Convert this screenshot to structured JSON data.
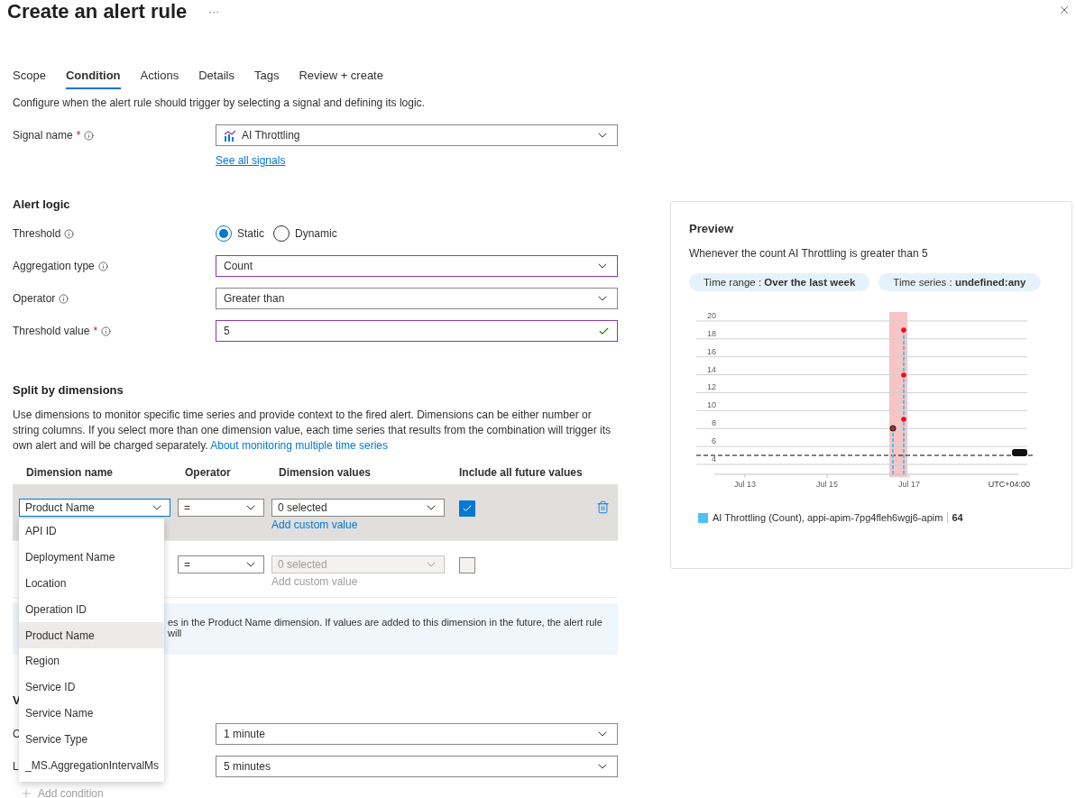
{
  "header": {
    "title": "Create an alert rule",
    "more": "···"
  },
  "tabs": [
    {
      "label": "Scope",
      "selected": false
    },
    {
      "label": "Condition",
      "selected": true
    },
    {
      "label": "Actions",
      "selected": false
    },
    {
      "label": "Details",
      "selected": false
    },
    {
      "label": "Tags",
      "selected": false
    },
    {
      "label": "Review + create",
      "selected": false
    }
  ],
  "intro": "Configure when the alert rule should trigger by selecting a signal and defining its logic.",
  "signal": {
    "label": "Signal name",
    "required_mark": "*",
    "info": true,
    "value": "AI Throttling",
    "link": "See all signals"
  },
  "alert_logic": {
    "heading": "Alert logic",
    "threshold": {
      "label": "Threshold",
      "info": true,
      "options": [
        {
          "label": "Static",
          "selected": true
        },
        {
          "label": "Dynamic",
          "selected": false
        }
      ]
    },
    "fields": [
      {
        "kind": "select",
        "label": "Aggregation type",
        "info": true,
        "value": "Count",
        "focused": true
      },
      {
        "kind": "select",
        "label": "Operator",
        "info": true,
        "value": "Greater than",
        "focused": false
      },
      {
        "kind": "text",
        "label": "Threshold value",
        "required_mark": "*",
        "info": true,
        "value": "5",
        "focused": true,
        "valid": true
      }
    ]
  },
  "split": {
    "heading": "Split by dimensions",
    "description": "Use dimensions to monitor specific time series and provide context to the fired alert. Dimensions can be either number or string columns. If you select more than one dimension value, each time series that results from the combination will trigger its own alert and will be charged separately.",
    "link": "About monitoring multiple time series",
    "columns": [
      "Dimension name",
      "Operator",
      "Dimension values",
      "Include all future values"
    ],
    "rows": [
      {
        "dimension": "Product Name",
        "operator": "=",
        "values": "0 selected",
        "add_custom": "Add custom value",
        "checked": true,
        "disabled": false,
        "highlighted": true
      },
      {
        "operator": "=",
        "values": "0 selected",
        "add_custom": "Add custom value",
        "checked": false,
        "disabled": true,
        "highlighted": false
      }
    ],
    "dropdown": [
      {
        "label": "API ID",
        "selected": false
      },
      {
        "label": "Deployment Name",
        "selected": false
      },
      {
        "label": "Location",
        "selected": false
      },
      {
        "label": "Operation ID",
        "selected": false
      },
      {
        "label": "Product Name",
        "selected": true
      },
      {
        "label": "Region",
        "selected": false
      },
      {
        "label": "Service ID",
        "selected": false
      },
      {
        "label": "Service Name",
        "selected": false
      },
      {
        "label": "Service Type",
        "selected": false
      },
      {
        "label": "_MS.AggregationIntervalMs",
        "selected": false
      }
    ],
    "info_text": "es in the Product Name dimension. If values are added to this dimension in the future, the alert rule will"
  },
  "when": {
    "heading": "V",
    "fields": [
      {
        "label": "C",
        "value": "1 minute"
      },
      {
        "label": "L",
        "value": "5 minutes"
      }
    ]
  },
  "add_condition": "Add condition",
  "preview": {
    "title": "Preview",
    "summary": "Whenever the count AI Throttling is greater than 5",
    "pills": [
      "Time range : **Over the last week**",
      "Time series : **undefined:any**"
    ],
    "chart": {
      "y_labels": [
        "20",
        "18",
        "16",
        "14",
        "12",
        "10",
        "8",
        "6",
        "4"
      ],
      "x_labels": [
        "Jul 13",
        "Jul 15",
        "Jul 17"
      ],
      "timezone": "UTC+04:00"
    },
    "legend": {
      "name": "AI Throttling (Count), appi-apim-7pg4fleh6wgj6-apim",
      "color": "#4cc2f7"
    },
    "legend_value": "64"
  }
}
